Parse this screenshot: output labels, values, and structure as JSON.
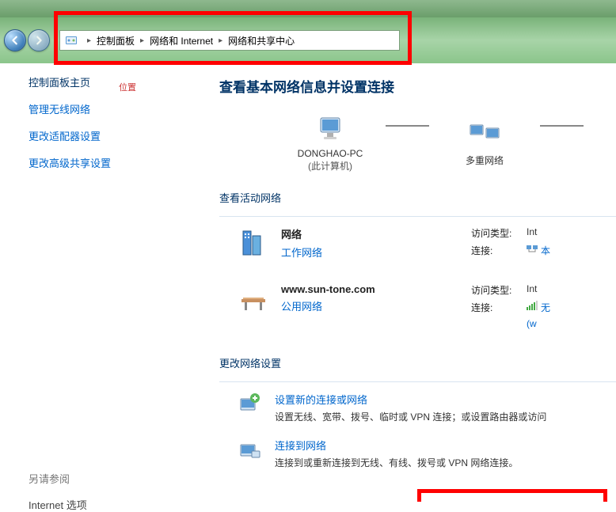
{
  "breadcrumb": {
    "parts": [
      "控制面板",
      "网络和 Internet",
      "网络和共享中心"
    ]
  },
  "sidebar": {
    "home": "控制面板主页",
    "loc_label": "位置",
    "links": [
      "管理无线网络",
      "更改适配器设置",
      "更改高级共享设置"
    ],
    "see_also_header": "另请参阅",
    "see_also": [
      "Internet 选项"
    ]
  },
  "main": {
    "title": "查看基本网络信息并设置连接",
    "map": {
      "node1": {
        "label": "DONGHAO-PC",
        "sub": "(此计算机)"
      },
      "node2": {
        "label": "多重网络"
      }
    },
    "active_header": "查看活动网络",
    "networks": [
      {
        "name": "网络",
        "type": "工作网络",
        "access_label": "访问类型:",
        "access_val": "Int",
        "conn_label": "连接:",
        "conn_val": "本"
      },
      {
        "name": "www.sun-tone.com",
        "type": "公用网络",
        "access_label": "访问类型:",
        "access_val": "Int",
        "conn_label": "连接:",
        "conn_val": "无",
        "conn_val2": "(w"
      }
    ],
    "settings_header": "更改网络设置",
    "tasks": [
      {
        "link": "设置新的连接或网络",
        "desc": "设置无线、宽带、拨号、临时或 VPN 连接；或设置路由器或访问"
      },
      {
        "link": "连接到网络",
        "desc": "连接到或重新连接到无线、有线、拨号或 VPN 网络连接。"
      }
    ]
  }
}
